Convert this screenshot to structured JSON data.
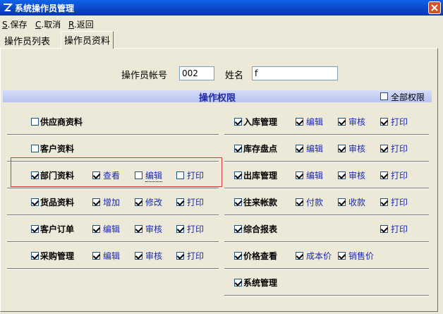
{
  "window": {
    "title": "系统操作员管理"
  },
  "menu": [
    {
      "key": "S",
      "label": ".保存"
    },
    {
      "key": "C",
      "label": ".取消"
    },
    {
      "key": "R",
      "label": ".返回"
    }
  ],
  "tabs": [
    "操作员列表",
    "操作员资料"
  ],
  "form": {
    "account_label": "操作员帐号",
    "account_value": "002",
    "name_label": "姓名",
    "name_value": "f"
  },
  "section": {
    "title": "操作权限",
    "all_label": "全部权限",
    "all_checked": false
  },
  "permissions": {
    "left": [
      {
        "name": "供应商资料",
        "checked": false,
        "subs": []
      },
      {
        "name": "客户资料",
        "checked": false,
        "subs": []
      },
      {
        "name": "部门资料",
        "checked": true,
        "subs": [
          {
            "label": "查看",
            "checked": true
          },
          {
            "label": "编辑",
            "checked": false
          },
          {
            "label": "打印",
            "checked": false
          }
        ]
      },
      {
        "name": "货品资料",
        "checked": true,
        "subs": [
          {
            "label": "增加",
            "checked": true
          },
          {
            "label": "修改",
            "checked": true
          },
          {
            "label": "打印",
            "checked": true
          }
        ]
      },
      {
        "name": "客户订单",
        "checked": true,
        "subs": [
          {
            "label": "编辑",
            "checked": true
          },
          {
            "label": "审核",
            "checked": true
          },
          {
            "label": "打印",
            "checked": true
          }
        ]
      },
      {
        "name": "采购管理",
        "checked": true,
        "subs": [
          {
            "label": "编辑",
            "checked": true
          },
          {
            "label": "审核",
            "checked": true
          },
          {
            "label": "打印",
            "checked": true
          }
        ]
      }
    ],
    "right": [
      {
        "name": "入库管理",
        "checked": true,
        "subs": [
          {
            "label": "编辑",
            "checked": true
          },
          {
            "label": "审核",
            "checked": true
          },
          {
            "label": "打印",
            "checked": true
          }
        ]
      },
      {
        "name": "库存盘点",
        "checked": true,
        "subs": [
          {
            "label": "编辑",
            "checked": true
          },
          {
            "label": "审核",
            "checked": true
          },
          {
            "label": "打印",
            "checked": true
          }
        ]
      },
      {
        "name": "出库管理",
        "checked": true,
        "subs": [
          {
            "label": "编辑",
            "checked": true
          },
          {
            "label": "审核",
            "checked": true
          },
          {
            "label": "打印",
            "checked": true
          }
        ]
      },
      {
        "name": "往来帐款",
        "checked": true,
        "subs": [
          {
            "label": "付款",
            "checked": true
          },
          {
            "label": "收款",
            "checked": true
          },
          {
            "label": "打印",
            "checked": true
          }
        ]
      },
      {
        "name": "综合报表",
        "checked": true,
        "subs": [
          {
            "label": "打印",
            "checked": true,
            "col": 2
          }
        ]
      },
      {
        "name": "价格查看",
        "checked": true,
        "subs": [
          {
            "label": "成本价",
            "checked": true
          },
          {
            "label": "销售价",
            "checked": true
          }
        ]
      },
      {
        "name": "系统管理",
        "checked": true,
        "subs": []
      }
    ]
  }
}
